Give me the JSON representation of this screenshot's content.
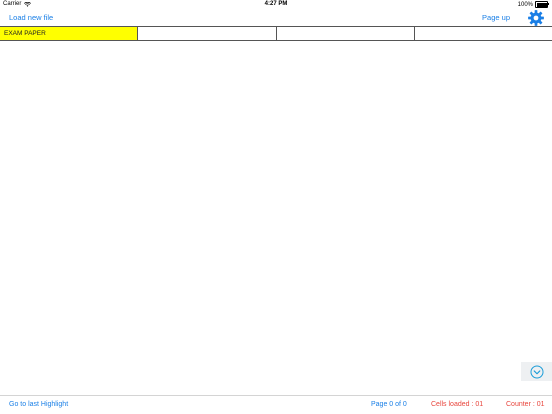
{
  "status_bar": {
    "carrier": "Carrier",
    "time": "4:27 PM",
    "battery": "100%"
  },
  "nav": {
    "load_file_label": "Load new file",
    "page_up_label": "Page up",
    "settings_icon": "gear-icon"
  },
  "cells": [
    {
      "text": "EXAM PAPER",
      "highlighted": true
    },
    {
      "text": "",
      "highlighted": false
    },
    {
      "text": "",
      "highlighted": false
    },
    {
      "text": "",
      "highlighted": false
    }
  ],
  "bottom_bar": {
    "go_last_highlight_label": "Go to last Highlight",
    "page_info": "Page 0 of 0",
    "cells_loaded": "Cells loaded : 01",
    "counter": "Counter : 01"
  },
  "colors": {
    "accent": "#1a7fe6",
    "highlight": "#ffff00",
    "alert": "#e8453c"
  }
}
